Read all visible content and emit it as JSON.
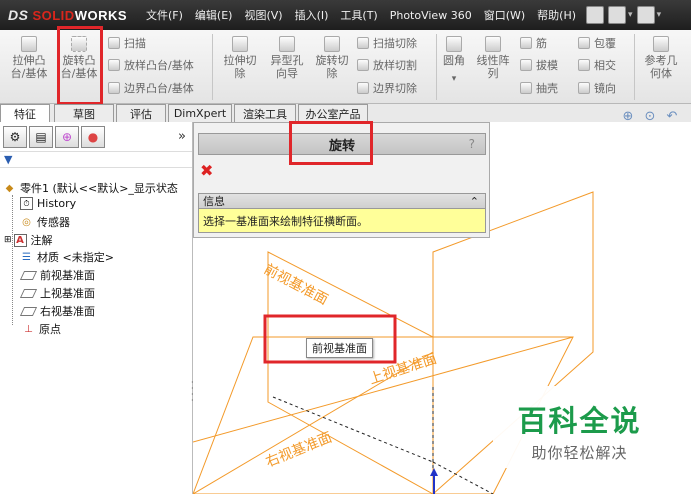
{
  "app": {
    "logo_prefix": "DS",
    "logo_solid": "SOLID",
    "logo_works": "WORKS",
    "brand_red": "#d9261c"
  },
  "menu": [
    "文件(F)",
    "编辑(E)",
    "视图(V)",
    "插入(I)",
    "工具(T)",
    "PhotoView 360",
    "窗口(W)",
    "帮助(H)"
  ],
  "commands": {
    "extrude_boss": "拉伸凸\n台/基体",
    "revolve_boss": "旋转凸\n台/基体",
    "sweep": "扫描",
    "loft": "放样凸台/基体",
    "boundary": "边界凸台/基体",
    "extrude_cut": "拉伸切\n除",
    "hole_wizard": "异型孔\n向导",
    "revolve_cut": "旋转切\n除",
    "swept_cut": "扫描切除",
    "lofted_cut": "放样切割",
    "boundary_cut": "边界切除",
    "fillet": "圆角",
    "linear_pattern": "线性阵\n列",
    "rib": "筋",
    "draft": "拔模",
    "shell": "抽壳",
    "wrap": "包覆",
    "intersect": "相交",
    "mirror": "镜向",
    "ref_geometry": "参考几\n何体"
  },
  "tabs": [
    "特征",
    "草图",
    "评估",
    "DimXpert",
    "渲染工具",
    "办公室产品"
  ],
  "tree": {
    "part": "零件1 (默认<<默认>_显示状态",
    "history": "History",
    "sensors": "传感器",
    "annotations": "注解",
    "material": "材质 <未指定>",
    "front_plane": "前视基准面",
    "top_plane": "上视基准面",
    "right_plane": "右视基准面",
    "origin": "原点",
    "more": "»"
  },
  "property_manager": {
    "title": "旋转",
    "help": "?",
    "info_header": "信息",
    "info_text": "选择一基准面来绘制特征横断面。"
  },
  "viewport": {
    "front_plane_label": "前视基准面",
    "top_plane_label": "上视基准面",
    "right_plane_label": "右视基准面",
    "tooltip": "前视基准面",
    "plane_color": "#f39a2a"
  },
  "watermark": {
    "title": "百科全说",
    "subtitle": "助你轻松解决",
    "color": "#1c9b4b"
  }
}
